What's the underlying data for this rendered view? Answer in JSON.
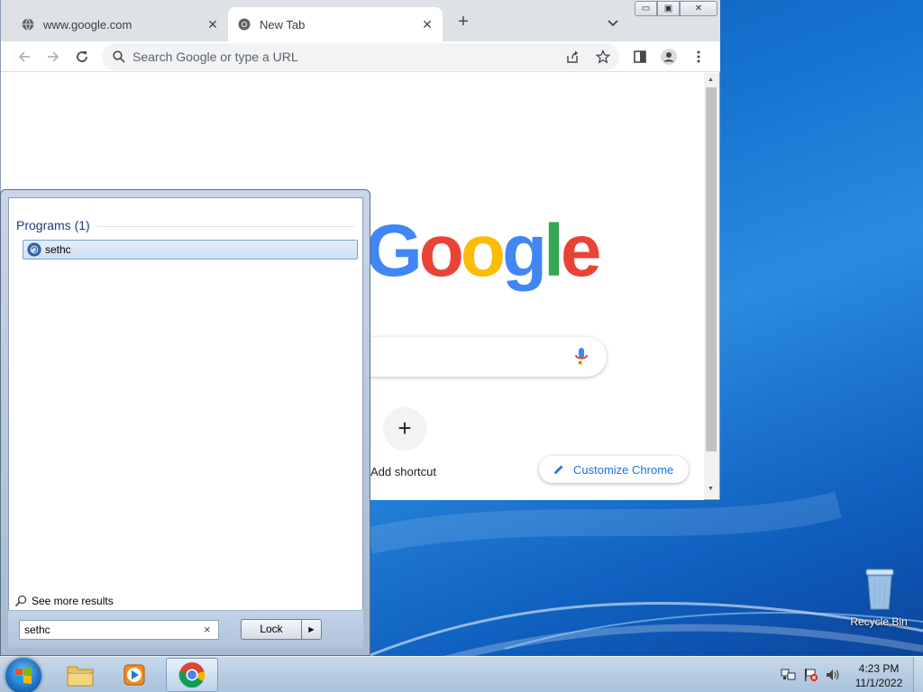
{
  "browser": {
    "tabs": [
      {
        "title": "www.google.com",
        "favicon": "globe-icon"
      },
      {
        "title": "New Tab",
        "favicon": "chrome-icon"
      }
    ],
    "tab_close_glyph": "✕",
    "new_tab_glyph": "+",
    "window_buttons": {
      "minimize": "▭",
      "maximize": "▣",
      "close": "✕"
    },
    "omnibox_placeholder": "Search Google or type a URL",
    "ntp": {
      "logo_letters": [
        {
          "ch": "G",
          "color": "#4285f4"
        },
        {
          "ch": "o",
          "color": "#ea4335"
        },
        {
          "ch": "o",
          "color": "#fbbc05"
        },
        {
          "ch": "g",
          "color": "#4285f4"
        },
        {
          "ch": "l",
          "color": "#34a853"
        },
        {
          "ch": "e",
          "color": "#ea4335"
        }
      ],
      "add_shortcut_glyph": "+",
      "add_shortcut_label": "Add shortcut",
      "customize_label": "Customize Chrome"
    }
  },
  "start_menu": {
    "programs_header": "Programs (1)",
    "results": [
      {
        "label": "sethc",
        "icon": "sethc-icon"
      }
    ],
    "see_more": "See more results",
    "search_value": "sethc",
    "clear_glyph": "×",
    "lock_label": "Lock",
    "lock_arrow": "▶"
  },
  "taskbar": {
    "apps": [
      "file-explorer-icon",
      "media-player-icon",
      "chrome-icon"
    ],
    "clock_time": "4:23 PM",
    "clock_date": "11/1/2022"
  },
  "desktop": {
    "recycle_bin_label": "Recycle Bin"
  }
}
